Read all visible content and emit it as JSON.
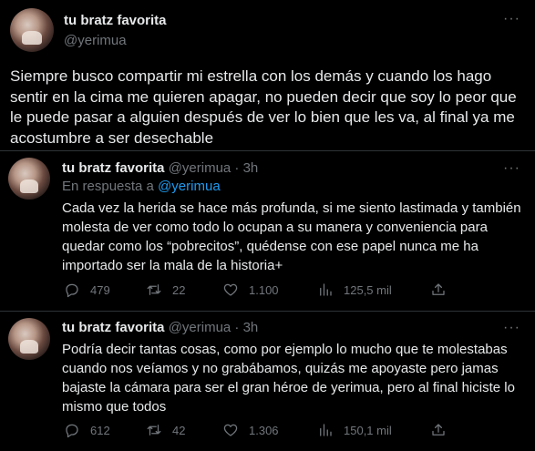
{
  "main_tweet": {
    "display_name": "tu bratz favorita",
    "handle": "@yerimua",
    "text": "Siempre busco compartir mi estrella con los demás y cuando los hago sentir en la cima me quieren apagar, no pueden decir que soy lo peor que le puede pasar a alguien después de ver lo bien que les va, al final ya me acostumbre a ser desechable"
  },
  "replies": [
    {
      "display_name": "tu bratz favorita",
      "meta": "@yerimua · 3h",
      "replying_prefix": "En respuesta a",
      "replying_mention": "@yerimua",
      "text": "Cada vez la herida se hace más profunda, si me siento lastimada y también molesta de ver como todo lo ocupan a su manera y conveniencia para quedar como los “pobrecitos”, quédense con ese papel nunca me ha importado ser la mala de la historia+",
      "replies_count": "479",
      "retweets_count": "22",
      "likes_count": "1.100",
      "views_count": "125,5 mil"
    },
    {
      "display_name": "tu bratz favorita",
      "meta": "@yerimua · 3h",
      "text": "Podría decir tantas cosas, como por ejemplo lo mucho que te molestabas cuando nos veíamos y no grabábamos, quizás me apoyaste pero jamas bajaste la cámara para ser el gran héroe de yerimua, pero al final hiciste lo mismo que todos",
      "replies_count": "612",
      "retweets_count": "42",
      "likes_count": "1.306",
      "views_count": "150,1 mil"
    }
  ],
  "icons": [
    "reply-icon",
    "retweet-icon",
    "like-icon",
    "views-icon",
    "share-icon",
    "more-icon"
  ],
  "colors": {
    "background": "#000000",
    "text": "#e7e9ea",
    "secondary": "#71767b",
    "accent": "#1d9bf0",
    "divider": "#2f3336"
  }
}
